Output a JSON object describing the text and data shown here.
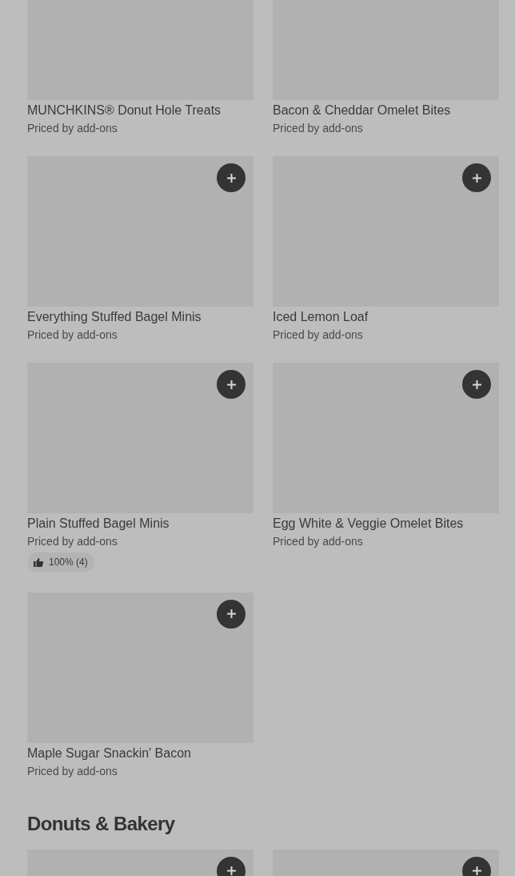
{
  "sections": [
    {
      "items": [
        {
          "title": "MUNCHKINS® Donut Hole Treats",
          "subtitle": "Priced by add-ons",
          "add_button": false
        },
        {
          "title": "Bacon & Cheddar Omelet Bites",
          "subtitle": "Priced by add-ons",
          "add_button": false
        },
        {
          "title": "Everything Stuffed Bagel Minis",
          "subtitle": "Priced by add-ons",
          "add_button": true
        },
        {
          "title": "Iced Lemon Loaf",
          "subtitle": "Priced by add-ons",
          "add_button": true
        },
        {
          "title": "Plain Stuffed Bagel Minis",
          "subtitle": "Priced by add-ons",
          "add_button": true,
          "rating": "100% (4)"
        },
        {
          "title": "Egg White & Veggie Omelet Bites",
          "subtitle": "Priced by add-ons",
          "add_button": true
        },
        {
          "title": "Maple Sugar Snackin' Bacon",
          "subtitle": "Priced by add-ons",
          "add_button": true
        }
      ]
    },
    {
      "title": "Donuts & Bakery",
      "items": [
        {
          "add_button": true
        },
        {
          "add_button": true
        }
      ]
    }
  ]
}
